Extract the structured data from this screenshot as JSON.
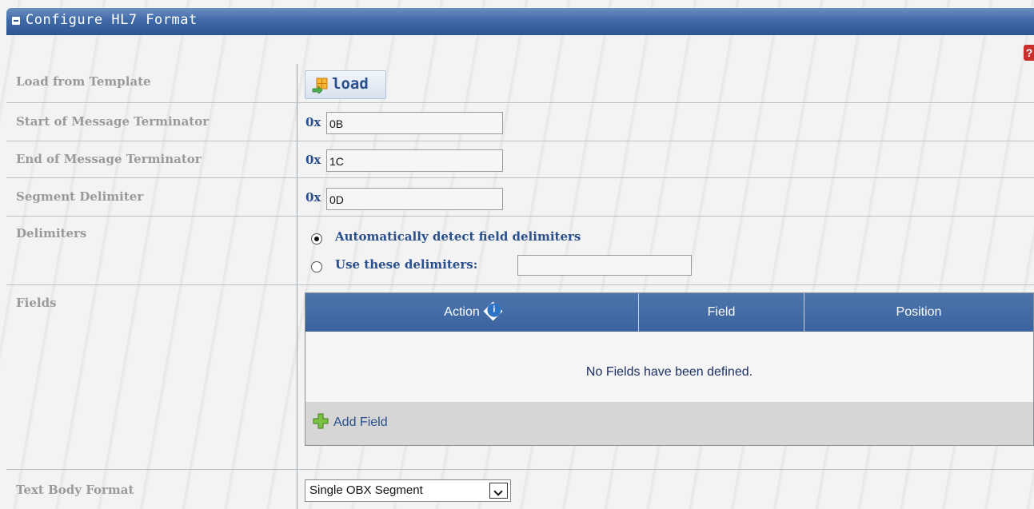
{
  "panel": {
    "title": "Configure HL7 Format"
  },
  "help": {
    "glyph": "?"
  },
  "form": {
    "load_template_label": "Load from Template",
    "load_button_label": "load",
    "start_terminator_label": "Start of Message Terminator",
    "end_terminator_label": "End of Message Terminator",
    "segment_delimiter_label": "Segment Delimiter",
    "hex_prefix": "0x",
    "start_terminator_value": "0B",
    "end_terminator_value": "1C",
    "segment_delimiter_value": "0D",
    "delimiters_label": "Delimiters",
    "auto_detect_label": "Automatically detect field delimiters",
    "use_these_label": "Use these delimiters:",
    "use_these_value": "",
    "fields_label": "Fields",
    "text_body_format_label": "Text Body Format",
    "text_body_format_value": "Single OBX Segment"
  },
  "fields_table": {
    "columns": [
      "Action",
      "Field",
      "Position"
    ],
    "empty_message": "No Fields have been defined.",
    "add_field_label": "Add Field"
  },
  "colors": {
    "header_blue": "#3f6aa8",
    "label_gray": "#9a9a9a",
    "value_blue": "#2a4f8c",
    "help_red": "#c9302c"
  }
}
